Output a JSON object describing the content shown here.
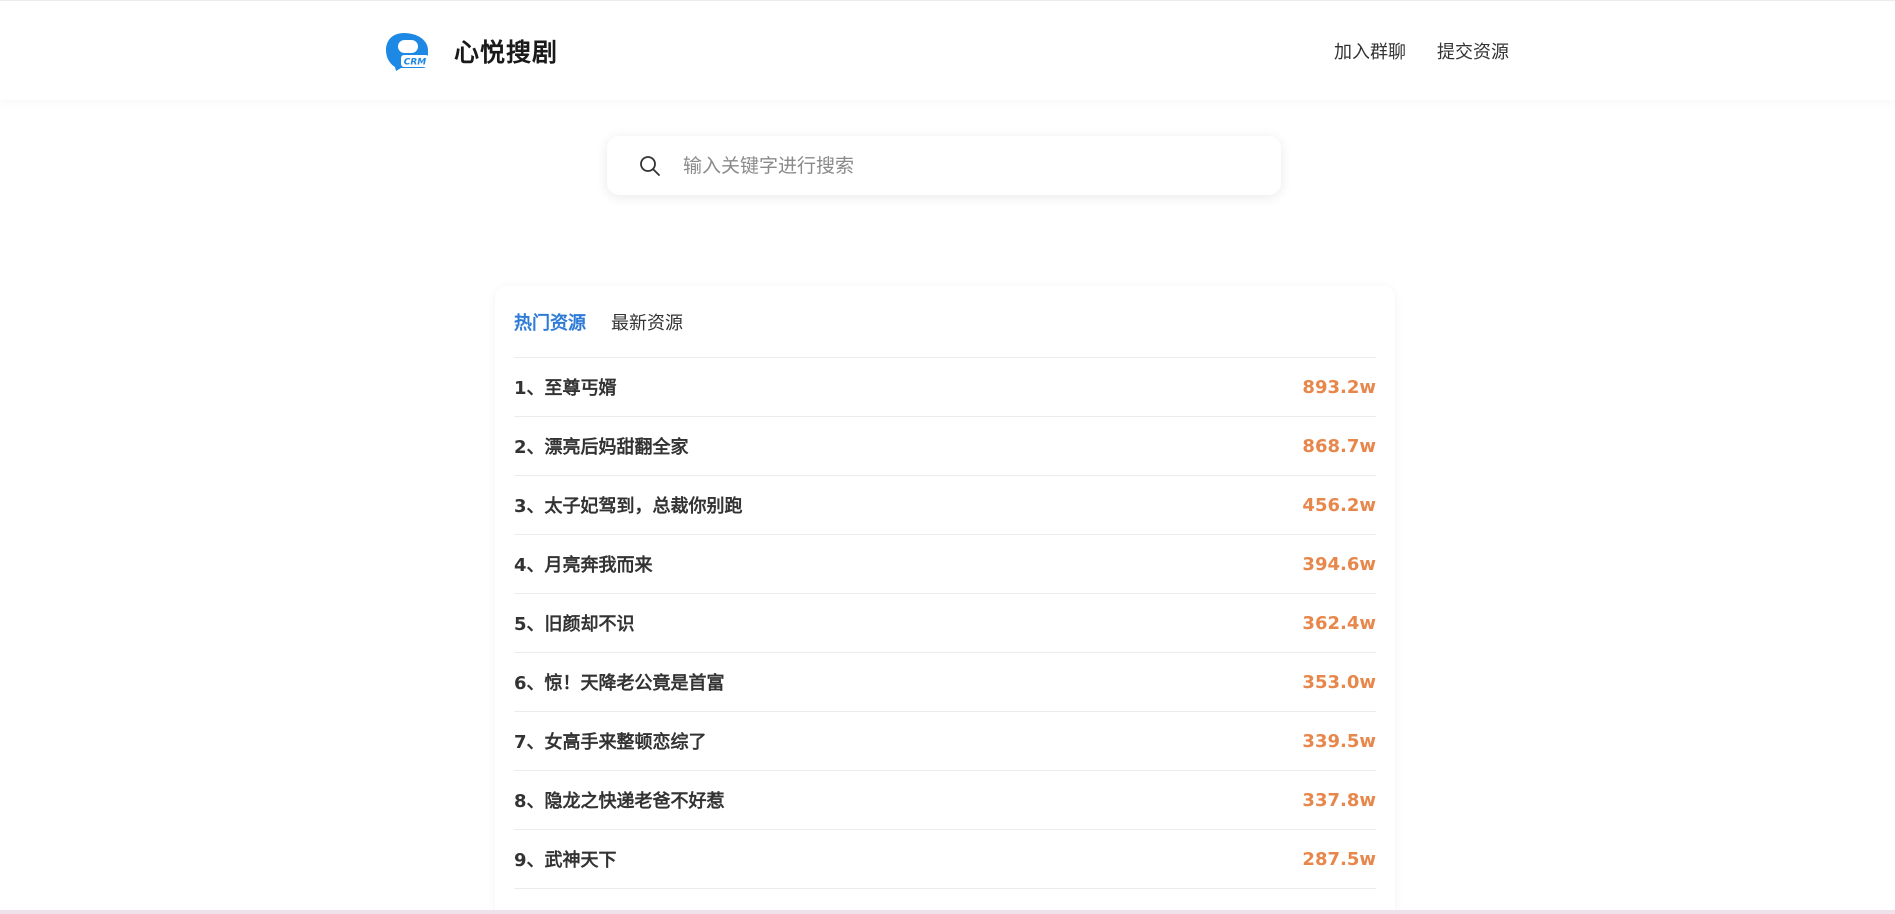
{
  "header": {
    "logo_text": "CRM",
    "site_name": "心悦搜剧",
    "nav": [
      {
        "label": "加入群聊"
      },
      {
        "label": "提交资源"
      }
    ]
  },
  "search": {
    "placeholder": "输入关键字进行搜索",
    "value": ""
  },
  "tabs": [
    {
      "label": "热门资源",
      "active": true
    },
    {
      "label": "最新资源",
      "active": false
    }
  ],
  "items": [
    {
      "title": "1、至尊丐婿",
      "count": "893.2w"
    },
    {
      "title": "2、漂亮后妈甜翻全家",
      "count": "868.7w"
    },
    {
      "title": "3、太子妃驾到，总裁你别跑",
      "count": "456.2w"
    },
    {
      "title": "4、月亮奔我而来",
      "count": "394.6w"
    },
    {
      "title": "5、旧颜却不识",
      "count": "362.4w"
    },
    {
      "title": "6、惊！天降老公竟是首富",
      "count": "353.0w"
    },
    {
      "title": "7、女高手来整顿恋综了",
      "count": "339.5w"
    },
    {
      "title": "8、隐龙之快递老爸不好惹",
      "count": "337.8w"
    },
    {
      "title": "9、武神天下",
      "count": "287.5w"
    }
  ],
  "colors": {
    "accent": "#2e7bd8",
    "count": "#e8874b",
    "logo": "#1e88e5"
  },
  "icons": {
    "logo": "crm-logo-icon",
    "search": "search-icon"
  }
}
